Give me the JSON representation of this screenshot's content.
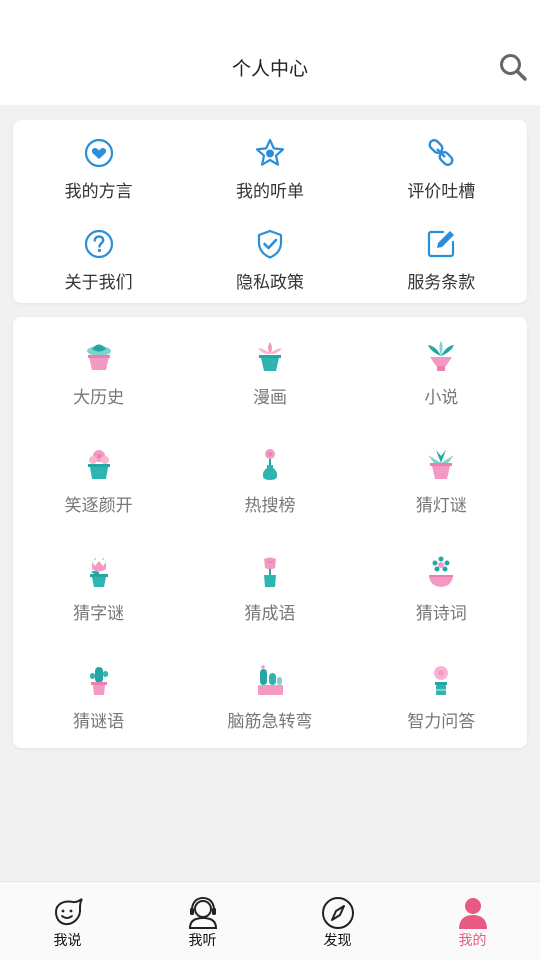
{
  "header": {
    "title": "个人中心"
  },
  "colors": {
    "accent": "#2a8ed8",
    "active_tab": "#e95a82",
    "pot_pink": "#f29ac3",
    "plant_teal": "#24a6a4"
  },
  "shortcuts": [
    {
      "label": "我的方言",
      "icon": "heart-icon"
    },
    {
      "label": "我的听单",
      "icon": "star-icon"
    },
    {
      "label": "评价吐槽",
      "icon": "link-icon"
    },
    {
      "label": "关于我们",
      "icon": "question-icon"
    },
    {
      "label": "隐私政策",
      "icon": "shield-icon"
    },
    {
      "label": "服务条款",
      "icon": "edit-icon"
    }
  ],
  "categories": [
    {
      "label": "大历史",
      "icon": "succulent-pot-icon"
    },
    {
      "label": "漫画",
      "icon": "lotus-pot-icon"
    },
    {
      "label": "小说",
      "icon": "palm-pot-icon"
    },
    {
      "label": "笑逐颜开",
      "icon": "flower-pot-icon"
    },
    {
      "label": "热搜榜",
      "icon": "vase-flower-icon"
    },
    {
      "label": "猜灯谜",
      "icon": "agave-pot-icon"
    },
    {
      "label": "猜字谜",
      "icon": "tulip-pot-icon"
    },
    {
      "label": "猜成语",
      "icon": "rose-pot-icon"
    },
    {
      "label": "猜诗词",
      "icon": "daisy-pot-icon"
    },
    {
      "label": "猜谜语",
      "icon": "cactus-pot-icon"
    },
    {
      "label": "脑筋急转弯",
      "icon": "cacti-pot-icon"
    },
    {
      "label": "智力问答",
      "icon": "blossom-pot-icon"
    }
  ],
  "tabs": [
    {
      "label": "我说",
      "icon": "chat-face-icon",
      "active": false
    },
    {
      "label": "我听",
      "icon": "headset-icon",
      "active": false
    },
    {
      "label": "发现",
      "icon": "compass-icon",
      "active": false
    },
    {
      "label": "我的",
      "icon": "user-icon",
      "active": true
    }
  ]
}
